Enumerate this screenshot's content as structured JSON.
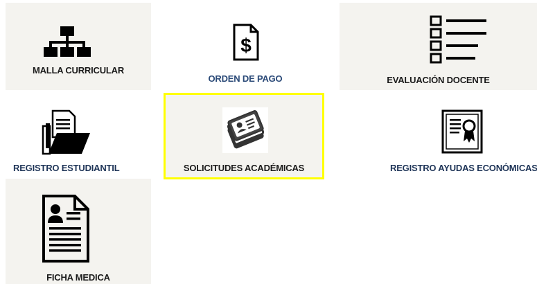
{
  "tiles": [
    {
      "label": "MALLA CURRICULAR",
      "icon": "org-chart-icon"
    },
    {
      "label": "ORDEN DE PAGO",
      "icon": "payment-document-icon"
    },
    {
      "label": "EVALUACIÓN DOCENTE",
      "icon": "checklist-icon"
    },
    {
      "label": "REGISTRO ESTUDIANTIL",
      "icon": "folder-documents-icon"
    },
    {
      "label": "SOLICITUDES ACADÉMICAS",
      "icon": "id-cards-stack-icon"
    },
    {
      "label": "REGISTRO AYUDAS ECONÓMICAS",
      "icon": "certificate-icon"
    },
    {
      "label": "FICHA MEDICA",
      "icon": "profile-document-icon"
    }
  ],
  "colors": {
    "tile_bg": "#f4f3ef",
    "highlight_border": "#ffff00",
    "label_blue": "#2b4a78",
    "label_dark": "#1b1b1b"
  }
}
